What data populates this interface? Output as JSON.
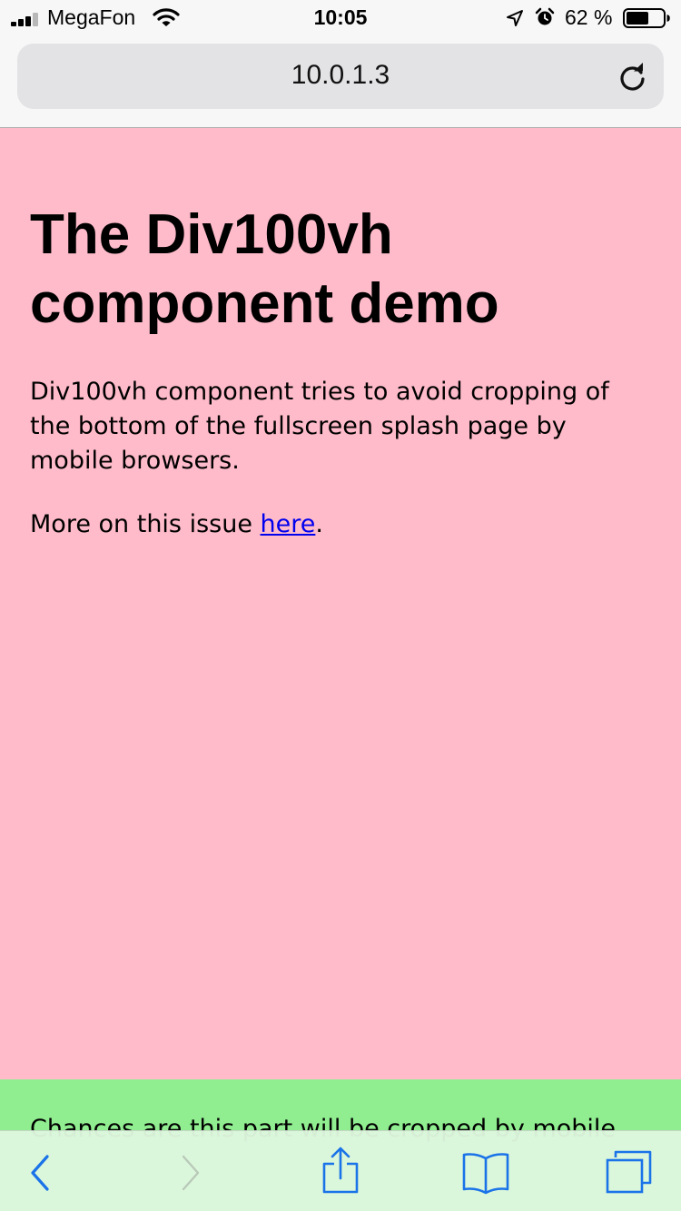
{
  "status_bar": {
    "carrier": "MegaFon",
    "time": "10:05",
    "battery_percent": "62 %",
    "battery_level": 0.62,
    "signal_bars": 3
  },
  "browser": {
    "url": "10.0.1.3"
  },
  "page": {
    "title": "The Div100vh component demo",
    "intro": "Div100vh component tries to avoid cropping of the bottom of the fullscreen splash page by mobile browsers.",
    "more_prefix": "More on this issue ",
    "more_link": "here",
    "more_suffix": ".",
    "cropped_text": "Chances are this part will be cropped by mobile",
    "colors": {
      "pink": "#ffbbca",
      "green": "#90ee90",
      "link": "#0000ee",
      "toolbar_accent": "#1a73e8"
    }
  },
  "toolbar": {
    "icons": [
      "back-icon",
      "forward-icon",
      "share-icon",
      "bookmarks-icon",
      "tabs-icon"
    ]
  }
}
